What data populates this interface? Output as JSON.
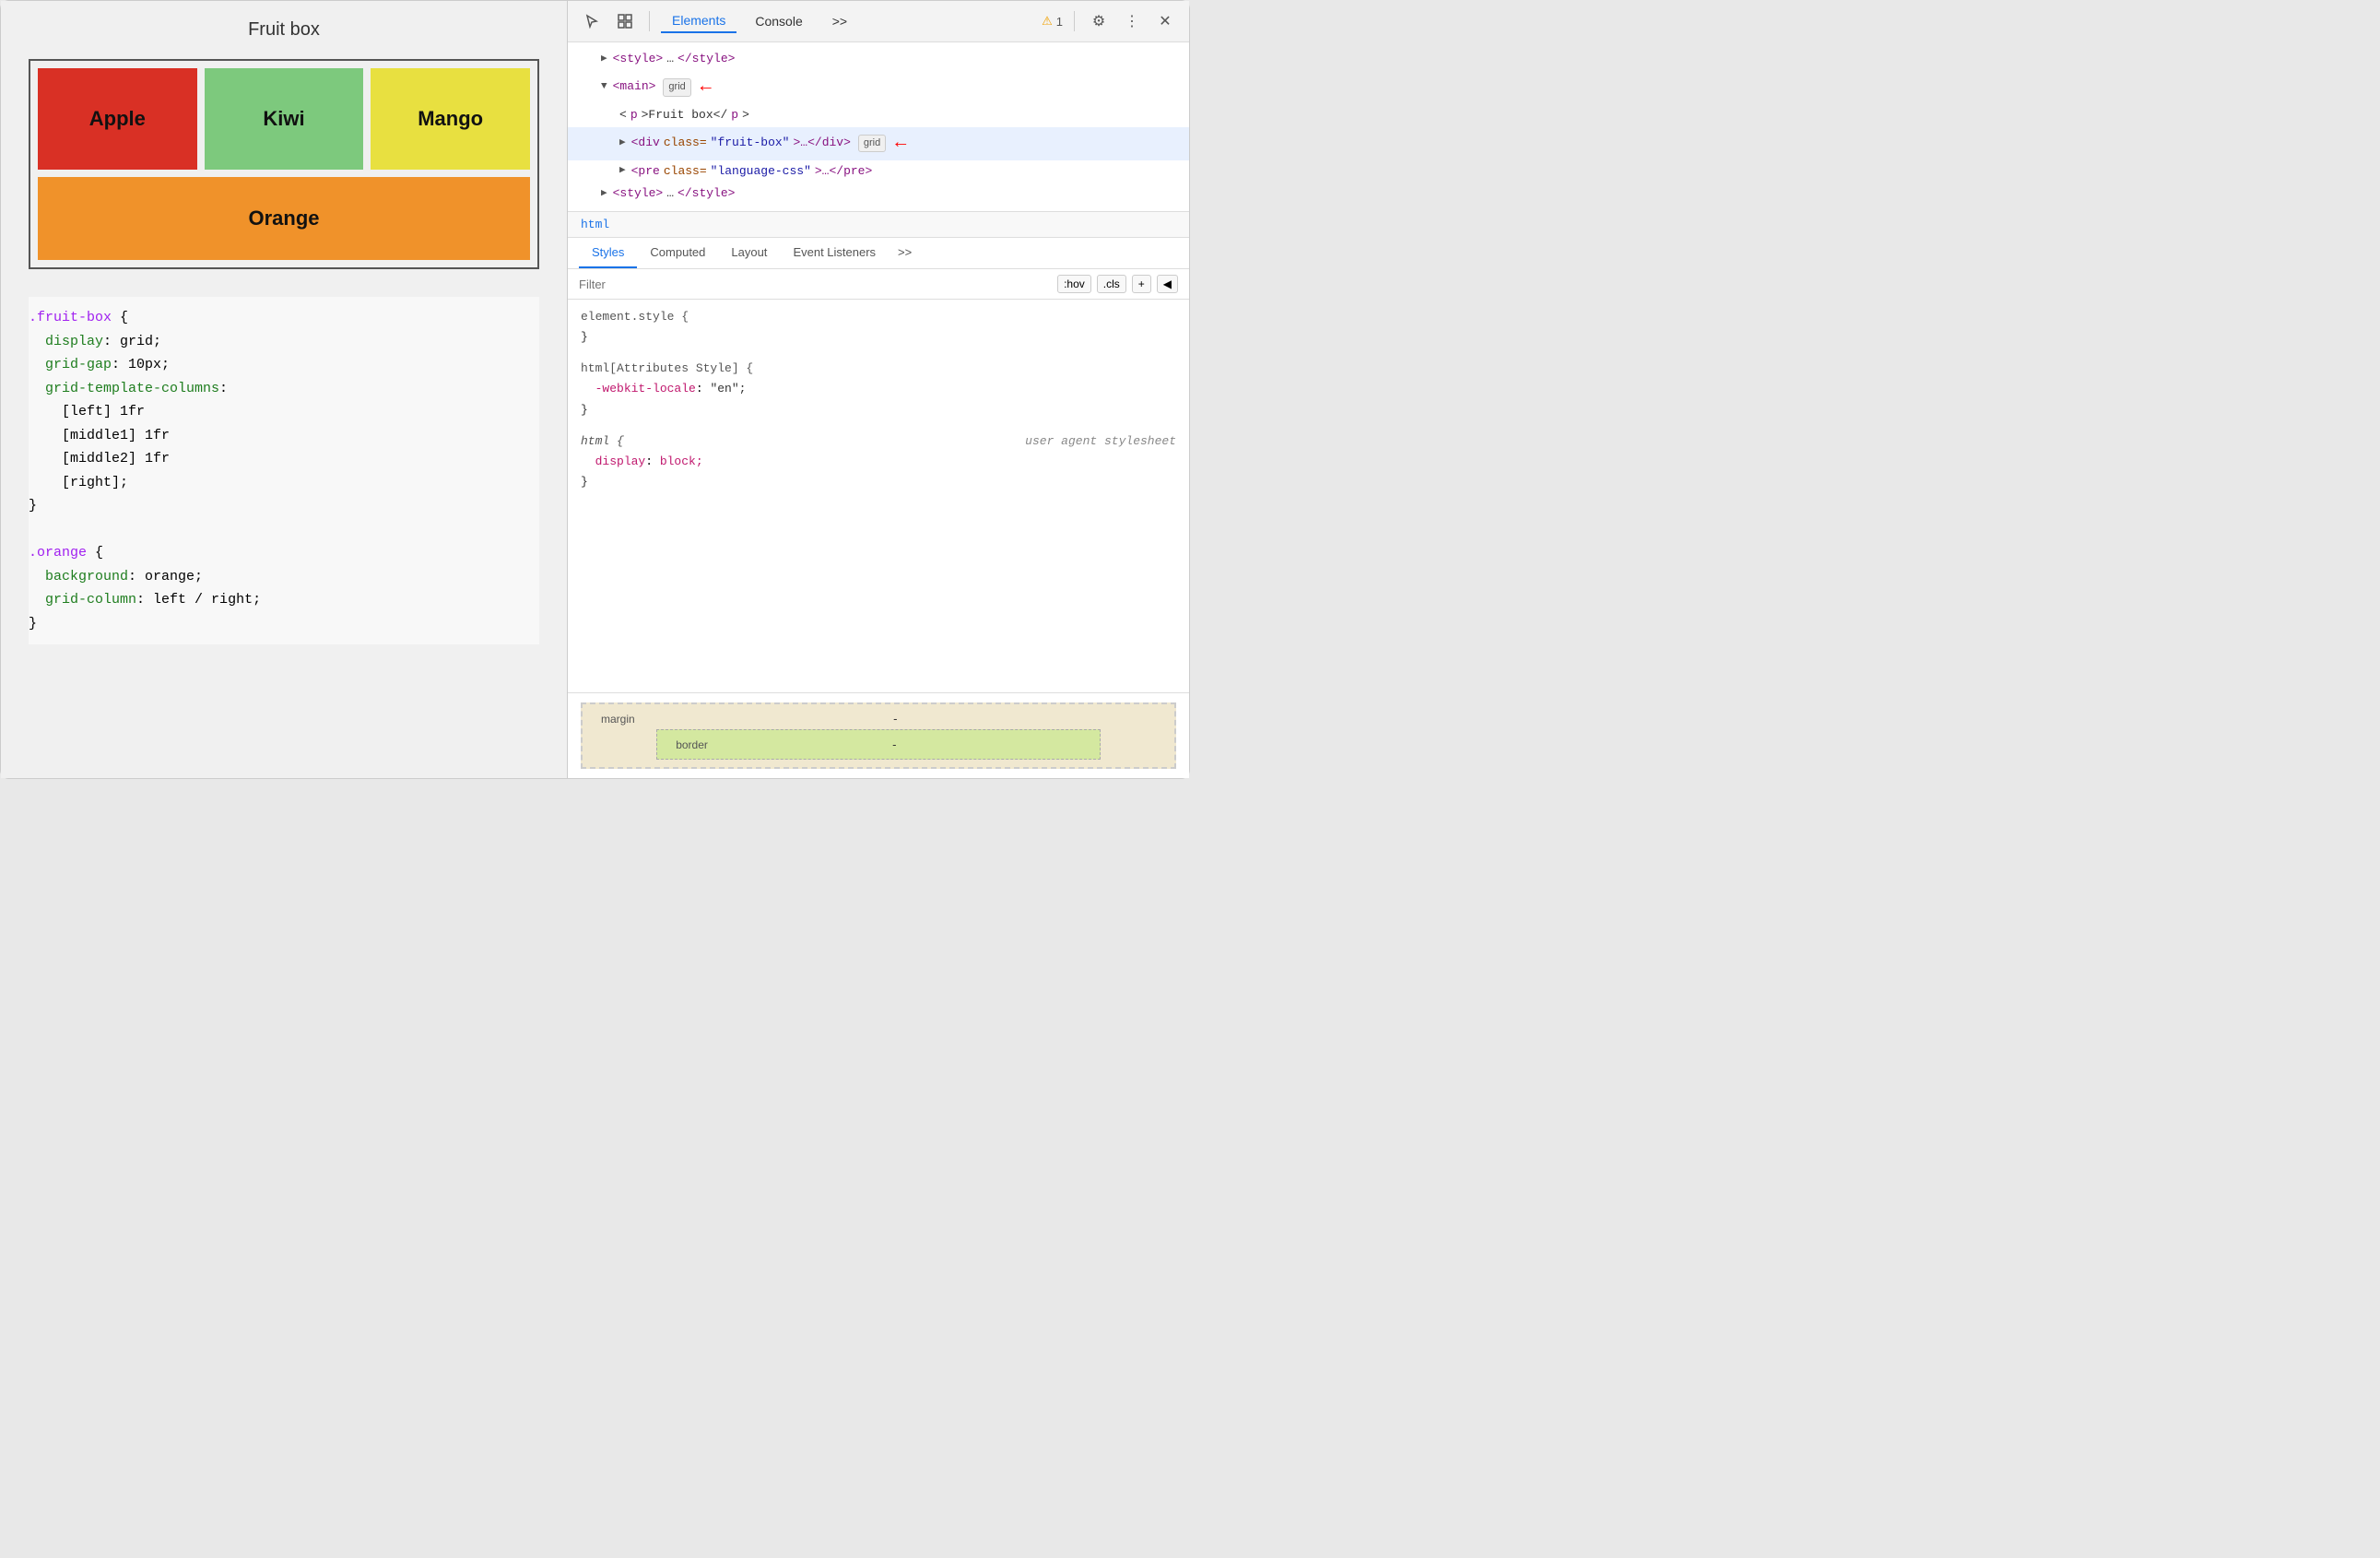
{
  "left": {
    "title": "Fruit box",
    "fruits": [
      {
        "name": "Apple",
        "class": "fruit-apple"
      },
      {
        "name": "Kiwi",
        "class": "fruit-kiwi"
      },
      {
        "name": "Mango",
        "class": "fruit-mango"
      },
      {
        "name": "Orange",
        "class": "fruit-orange"
      }
    ],
    "code_blocks": [
      {
        "selector": ".fruit-box",
        "properties": [
          {
            "name": "display",
            "value": "grid;"
          },
          {
            "name": "grid-gap",
            "value": "10px;"
          },
          {
            "name": "grid-template-columns",
            "value": ""
          },
          {
            "indent": "    ",
            "value": "[left] 1fr"
          },
          {
            "indent": "    ",
            "value": "[middle1] 1fr"
          },
          {
            "indent": "    ",
            "value": "[middle2] 1fr"
          },
          {
            "indent": "    ",
            "value": "[right];"
          }
        ]
      },
      {
        "selector": ".orange",
        "properties": [
          {
            "name": "background",
            "value": "orange;"
          },
          {
            "name": "grid-column",
            "value": "left / right;"
          }
        ]
      }
    ]
  },
  "devtools": {
    "tabs": [
      "Elements",
      "Console",
      ">>"
    ],
    "active_tab": "Elements",
    "warning_count": "1",
    "dom_nodes": [
      {
        "indent": 0,
        "arrow": "▶",
        "content": "<style>…</style>"
      },
      {
        "indent": 0,
        "arrow": "▼",
        "content": "<main>",
        "badge": "grid",
        "arrow_indicator": true
      },
      {
        "indent": 1,
        "arrow": "",
        "content": "<p>Fruit box</p>"
      },
      {
        "indent": 1,
        "arrow": "▶",
        "content": "<div class=\"fruit-box\">…</div>",
        "badge": "grid",
        "arrow_indicator": true
      },
      {
        "indent": 1,
        "arrow": "▶",
        "content": "<pre class=\"language-css\">…</pre>"
      },
      {
        "indent": 0,
        "arrow": "▶",
        "content": "<style>…</style>"
      }
    ],
    "breadcrumb": "html",
    "styles_tabs": [
      "Styles",
      "Computed",
      "Layout",
      "Event Listeners",
      ">>"
    ],
    "active_styles_tab": "Styles",
    "filter_placeholder": "Filter",
    "filter_actions": [
      ":hov",
      ".cls",
      "+",
      "◀"
    ],
    "css_rules": [
      {
        "selector": "element.style {",
        "properties": [],
        "close": "}"
      },
      {
        "selector": "html[Attributes Style] {",
        "italic": false,
        "properties": [
          {
            "name": "-webkit-locale",
            "value": "\"en\";"
          }
        ],
        "close": "}"
      },
      {
        "selector": "html {",
        "italic": true,
        "comment": "user agent stylesheet",
        "properties": [
          {
            "name": "display",
            "value": "block;"
          }
        ],
        "close": "}"
      }
    ],
    "box_model": {
      "margin_label": "margin",
      "margin_value": "-",
      "border_label": "border",
      "border_value": "-"
    }
  }
}
